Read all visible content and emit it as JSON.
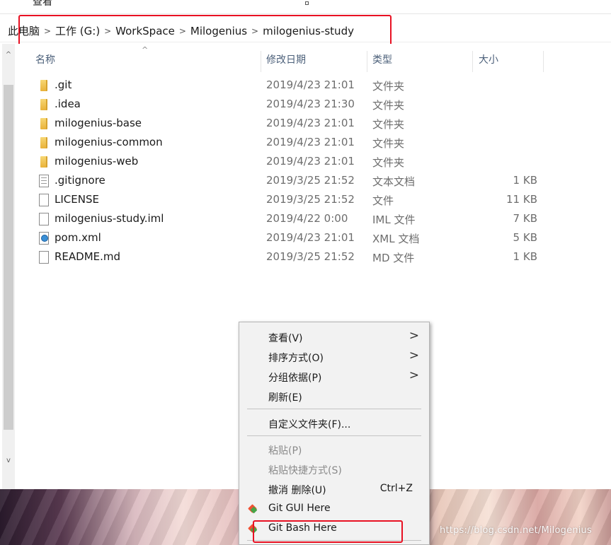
{
  "menu_bar": {
    "view_label": "查看"
  },
  "breadcrumb": {
    "items": [
      "此电脑",
      "工作 (G:)",
      "WorkSpace",
      "Milogenius",
      "milogenius-study"
    ]
  },
  "columns": {
    "name": "名称",
    "date": "修改日期",
    "type": "类型",
    "size": "大小"
  },
  "files": [
    {
      "name": ".git",
      "date": "2019/4/23 21:01",
      "type": "文件夹",
      "size": "",
      "icon": "folder-icon"
    },
    {
      "name": ".idea",
      "date": "2019/4/23 21:30",
      "type": "文件夹",
      "size": "",
      "icon": "folder-icon"
    },
    {
      "name": "milogenius-base",
      "date": "2019/4/23 21:01",
      "type": "文件夹",
      "size": "",
      "icon": "folder-icon"
    },
    {
      "name": "milogenius-common",
      "date": "2019/4/23 21:01",
      "type": "文件夹",
      "size": "",
      "icon": "folder-icon"
    },
    {
      "name": "milogenius-web",
      "date": "2019/4/23 21:01",
      "type": "文件夹",
      "size": "",
      "icon": "folder-icon"
    },
    {
      "name": ".gitignore",
      "date": "2019/3/25 21:52",
      "type": "文本文档",
      "size": "1 KB",
      "icon": "text-file-icon"
    },
    {
      "name": "LICENSE",
      "date": "2019/3/25 21:52",
      "type": "文件",
      "size": "11 KB",
      "icon": "file-icon"
    },
    {
      "name": "milogenius-study.iml",
      "date": "2019/4/22 0:00",
      "type": "IML 文件",
      "size": "7 KB",
      "icon": "file-icon"
    },
    {
      "name": "pom.xml",
      "date": "2019/4/23 21:01",
      "type": "XML 文档",
      "size": "5 KB",
      "icon": "xml-file-icon"
    },
    {
      "name": "README.md",
      "date": "2019/3/25 21:52",
      "type": "MD 文件",
      "size": "1 KB",
      "icon": "file-icon"
    }
  ],
  "context_menu": {
    "view": "查看(V)",
    "sort_by": "排序方式(O)",
    "group_by": "分组依据(P)",
    "refresh": "刷新(E)",
    "customize_folder": "自定义文件夹(F)...",
    "paste": "粘贴(P)",
    "paste_shortcut": "粘贴快捷方式(S)",
    "undo_delete": "撤消 删除(U)",
    "undo_shortcut": "Ctrl+Z",
    "git_gui": "Git GUI Here",
    "git_bash": "Git Bash Here"
  },
  "watermark": "https://blog.csdn.net/Milogenius",
  "colors": {
    "highlight_red": "#e81123",
    "folder_yellow": "#e9b23a",
    "header_text": "#4c607a",
    "menu_bg": "#f2f2f2"
  }
}
